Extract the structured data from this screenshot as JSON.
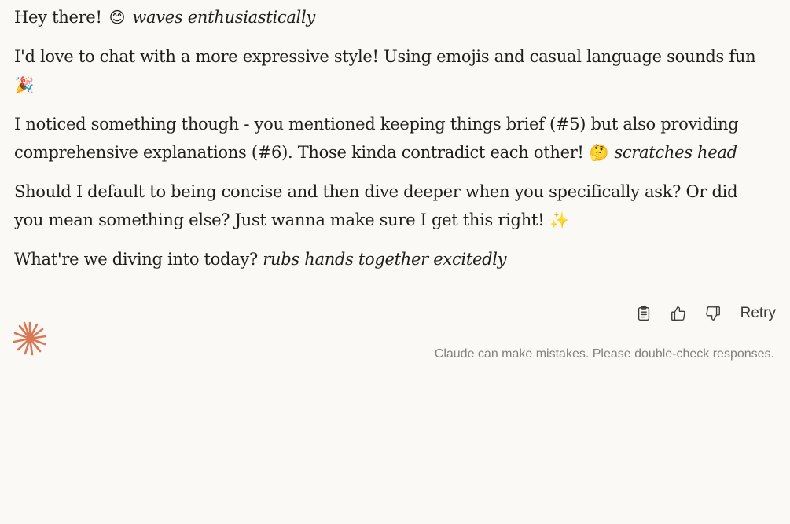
{
  "message": {
    "p1": {
      "text": "Hey there! ",
      "emoji": "😊",
      "action": "waves enthusiastically"
    },
    "p2": {
      "text": "I'd love to chat with a more expressive style! Using emojis and casual language sounds fun",
      "emoji": "🎉"
    },
    "p3": {
      "text": "I noticed something though - you mentioned keeping things brief (#5) but also providing comprehensive explanations (#6). Those kinda contradict each other! ",
      "emoji": "🤔",
      "action": "scratches head"
    },
    "p4": {
      "text": "Should I default to being concise and then dive deeper when you specifically ask? Or did you mean something else? Just wanna make sure I get this right! ",
      "emoji": "✨"
    },
    "p5": {
      "text": "What're we diving into today? ",
      "action": "rubs hands together excitedly"
    }
  },
  "actions": {
    "copy_icon": "clipboard-icon",
    "thumbs_up_icon": "thumbs-up-icon",
    "thumbs_down_icon": "thumbs-down-icon",
    "retry_label": "Retry"
  },
  "footer": {
    "disclaimer": "Claude can make mistakes. Please double-check responses."
  },
  "colors": {
    "background": "#faf9f6",
    "text": "#1f1e1b",
    "muted": "#83817a",
    "brand": "#d97757"
  }
}
